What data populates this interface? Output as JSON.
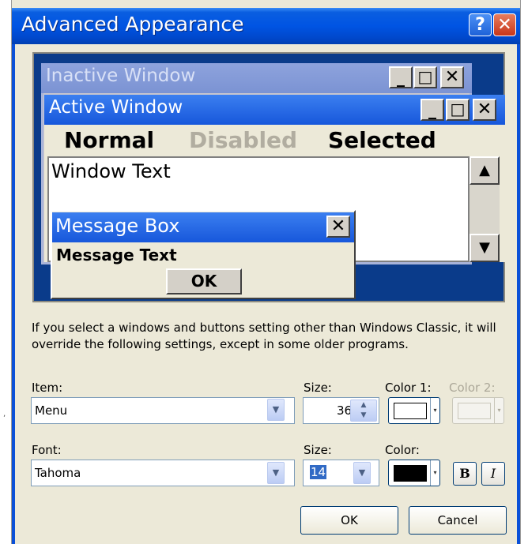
{
  "window": {
    "title": "Advanced Appearance",
    "help_glyph": "?",
    "close_glyph": "✕"
  },
  "preview": {
    "inactive_title": "Inactive Window",
    "active_title": "Active Window",
    "min_glyph": "_",
    "max_glyph": "□",
    "close_glyph": "✕",
    "menu": {
      "normal": "Normal",
      "disabled": "Disabled",
      "selected": "Selected"
    },
    "window_text": "Window Text",
    "scroll_up_glyph": "▲",
    "scroll_down_glyph": "▼",
    "message_box": {
      "title": "Message Box",
      "close_glyph": "✕",
      "text": "Message Text",
      "ok_label": "OK"
    }
  },
  "info_text": "If you select a windows and buttons setting other than Windows Classic, it will override the following settings, except in some older programs.",
  "item": {
    "label": "Item:",
    "value": "Menu",
    "size_label": "Size:",
    "size_value": "36",
    "color1_label": "Color 1:",
    "color1_value": "#ffffff",
    "color2_label": "Color 2:"
  },
  "font": {
    "label": "Font:",
    "value": "Tahoma",
    "size_label": "Size:",
    "size_value": "14",
    "color_label": "Color:",
    "color_value": "#000000",
    "bold_label": "B",
    "italic_label": "I"
  },
  "buttons": {
    "ok": "OK",
    "cancel": "Cancel"
  },
  "icons": {
    "dropdown": "▼",
    "spin_up": "▲",
    "spin_down": "▼",
    "color_dropdown": "▾"
  },
  "colors": {
    "titlebar": "#0054e3",
    "preview_bg": "#0a3b8a",
    "dialog_bg": "#ECE9D8",
    "selection": "#316ac5"
  }
}
